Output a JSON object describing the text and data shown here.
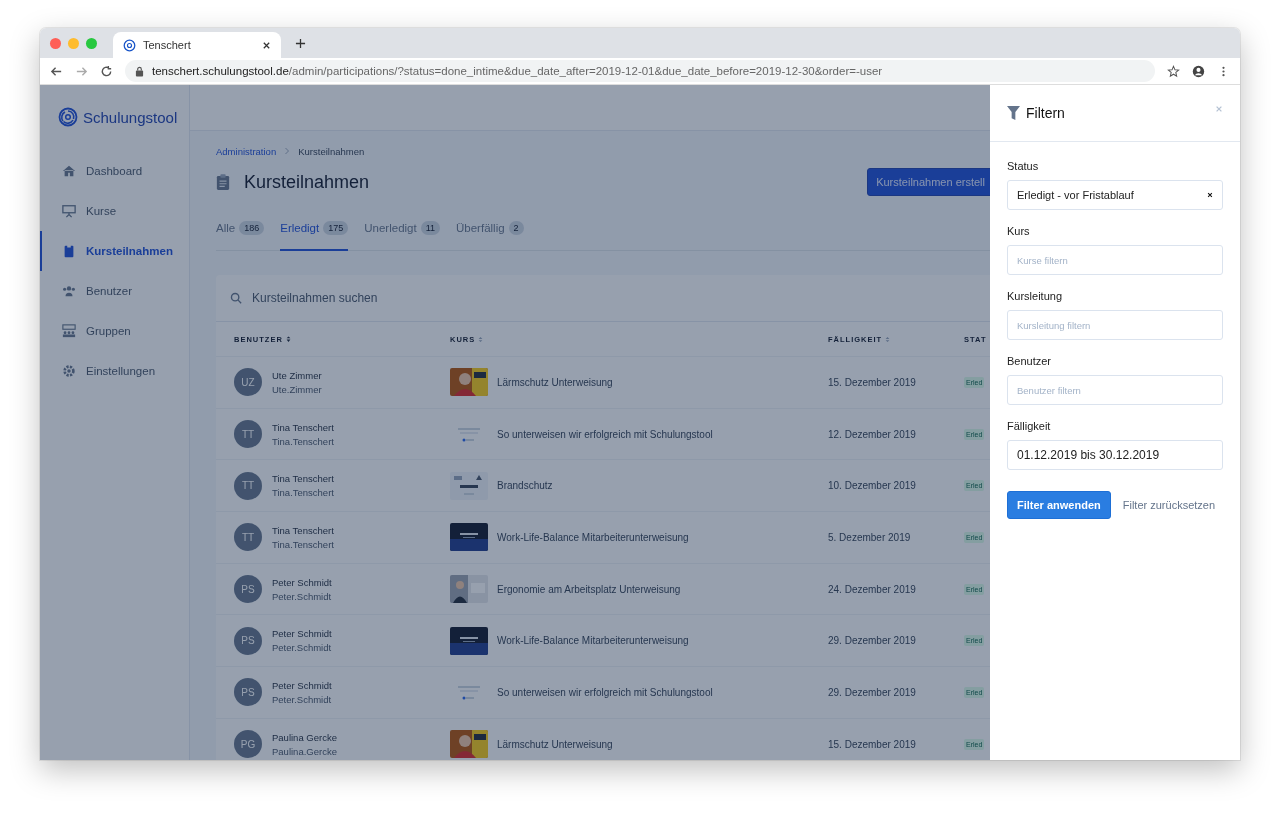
{
  "browser": {
    "tab_title": "Tenschert",
    "url_host": "tenschert.schulungstool.de",
    "url_path": "/admin/participations/?status=done_intime&due_date_after=2019-12-01&due_date_before=2019-12-30&order=-user"
  },
  "sidebar": {
    "logo": "Schulungstool",
    "items": [
      {
        "label": "Dashboard",
        "selected": false
      },
      {
        "label": "Kurse",
        "selected": false
      },
      {
        "label": "Kursteilnahmen",
        "selected": true
      },
      {
        "label": "Benutzer",
        "selected": false
      },
      {
        "label": "Gruppen",
        "selected": false
      },
      {
        "label": "Einstellungen",
        "selected": false
      }
    ]
  },
  "breadcrumb": [
    "Administration",
    "Kursteilnahmen"
  ],
  "page_title": "Kursteilnahmen",
  "create_button": "Kursteilnahmen erstell",
  "tabs": [
    {
      "label": "Alle",
      "count": "186",
      "selected": false
    },
    {
      "label": "Erledigt",
      "count": "175",
      "selected": true
    },
    {
      "label": "Unerledigt",
      "count": "11",
      "selected": false
    },
    {
      "label": "Überfällig",
      "count": "2",
      "selected": false
    }
  ],
  "search": {
    "placeholder": "Kursteilnahmen suchen"
  },
  "table": {
    "columns": [
      {
        "label": "BENUTZER",
        "sorted": true
      },
      {
        "label": "KURS",
        "sorted": false
      },
      {
        "label": "FÄLLIGKEIT",
        "sorted": false
      },
      {
        "label": "STAT"
      }
    ],
    "rows": [
      {
        "initials": "UZ",
        "name": "Ute Zimmer",
        "username": "Ute.Zimmer",
        "course": "Lärmschutz Unterweisung",
        "due": "15. Dezember 2019",
        "status": "Erled"
      },
      {
        "initials": "TT",
        "name": "Tina Tenschert",
        "username": "Tina.Tenschert",
        "course": "So unterweisen wir erfolgreich mit Schulungstool",
        "due": "12. Dezember 2019",
        "status": "Erled"
      },
      {
        "initials": "TT",
        "name": "Tina Tenschert",
        "username": "Tina.Tenschert",
        "course": "Brandschutz",
        "due": "10. Dezember 2019",
        "status": "Erled"
      },
      {
        "initials": "TT",
        "name": "Tina Tenschert",
        "username": "Tina.Tenschert",
        "course": "Work-Life-Balance Mitarbeiterunterweisung",
        "due": "5. Dezember 2019",
        "status": "Erled"
      },
      {
        "initials": "PS",
        "name": "Peter Schmidt",
        "username": "Peter.Schmidt",
        "course": "Ergonomie am Arbeitsplatz Unterweisung",
        "due": "24. Dezember 2019",
        "status": "Erled"
      },
      {
        "initials": "PS",
        "name": "Peter Schmidt",
        "username": "Peter.Schmidt",
        "course": "Work-Life-Balance Mitarbeiterunterweisung",
        "due": "29. Dezember 2019",
        "status": "Erled"
      },
      {
        "initials": "PS",
        "name": "Peter Schmidt",
        "username": "Peter.Schmidt",
        "course": "So unterweisen wir erfolgreich mit Schulungstool",
        "due": "29. Dezember 2019",
        "status": "Erled"
      },
      {
        "initials": "PG",
        "name": "Paulina Gercke",
        "username": "Paulina.Gercke",
        "course": "Lärmschutz Unterweisung",
        "due": "15. Dezember 2019",
        "status": "Erled"
      }
    ]
  },
  "filter_panel": {
    "title": "Filtern",
    "fields": [
      {
        "label": "Status",
        "kind": "select",
        "value": "Erledigt - vor Fristablauf"
      },
      {
        "label": "Kurs",
        "kind": "text",
        "placeholder": "Kurse filtern"
      },
      {
        "label": "Kursleitung",
        "kind": "text",
        "placeholder": "Kursleitung filtern"
      },
      {
        "label": "Benutzer",
        "kind": "text",
        "placeholder": "Benutzer filtern"
      },
      {
        "label": "Fälligkeit",
        "kind": "text",
        "value": "01.12.2019 bis 30.12.2019"
      }
    ],
    "apply_button": "Filter anwenden",
    "reset_link": "Filter zurücksetzen"
  }
}
